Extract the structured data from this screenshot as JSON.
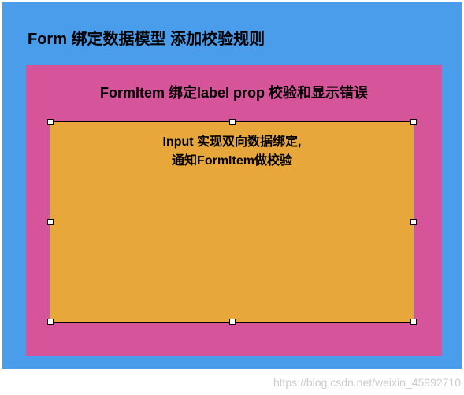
{
  "form": {
    "title": "Form  绑定数据模型 添加校验规则"
  },
  "formItem": {
    "title": "FormItem 绑定label prop  校验和显示错误"
  },
  "input": {
    "line1": "Input 实现双向数据绑定,",
    "line2": "通知FormItem做校验"
  },
  "watermark": "https://blog.csdn.net/weixin_45992710"
}
